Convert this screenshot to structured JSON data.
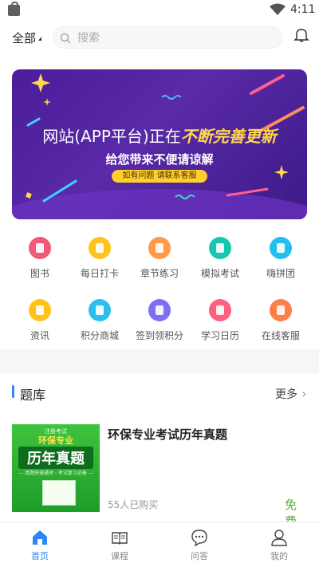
{
  "status_bar": {
    "time": "4:11"
  },
  "header": {
    "category_label": "全部",
    "search_placeholder": "搜索"
  },
  "banner": {
    "title_plain": "网站(APP平台)正在",
    "title_highlight": "不断完善更新",
    "subtitle": "给您带来不便请谅解",
    "tag": "如有问题  请联系客服"
  },
  "grid": {
    "items": [
      {
        "label": "图书",
        "color": "#f05a78"
      },
      {
        "label": "每日打卡",
        "color": "#ffc21a"
      },
      {
        "label": "章节练习",
        "color": "#ff9a4a"
      },
      {
        "label": "模拟考试",
        "color": "#16c7b0"
      },
      {
        "label": "嗨拼团",
        "color": "#22c0ee"
      },
      {
        "label": "资讯",
        "color": "#ffc21a"
      },
      {
        "label": "积分商城",
        "color": "#2bbff0"
      },
      {
        "label": "签到领积分",
        "color": "#7d6ef2"
      },
      {
        "label": "学习日历",
        "color": "#ff5f7e"
      },
      {
        "label": "在线客服",
        "color": "#ff7e45"
      }
    ]
  },
  "question_bank": {
    "title": "题库",
    "more": "更多",
    "course": {
      "title": "环保专业考试历年真题",
      "buyers": "55人已购买",
      "price": "免费",
      "thumb": {
        "line1": "注册考试",
        "line2": "环保专业",
        "line3": "历年真题",
        "line4": "— 真题快速通关 · 考试复习必备 —"
      }
    }
  },
  "tabbar": {
    "items": [
      {
        "label": "首页"
      },
      {
        "label": "课程"
      },
      {
        "label": "问答"
      },
      {
        "label": "我的"
      }
    ]
  },
  "colors": {
    "accent": "#2f86f6",
    "price_green": "#5cae3d"
  }
}
